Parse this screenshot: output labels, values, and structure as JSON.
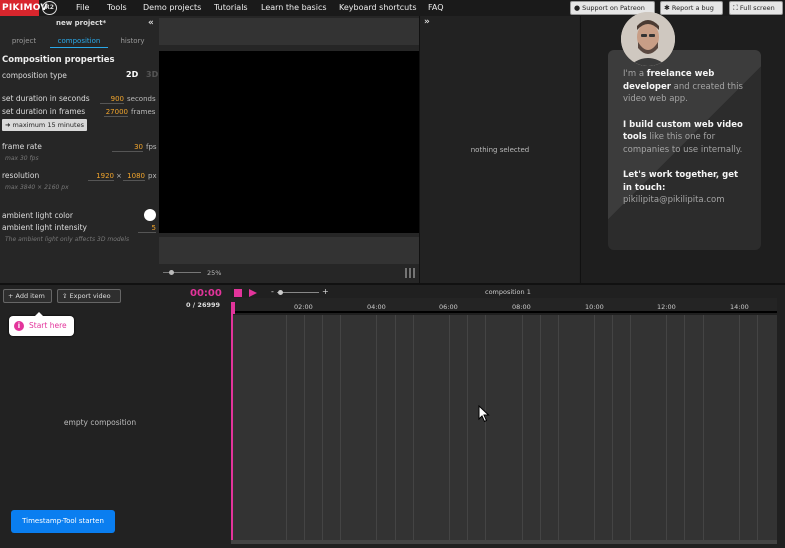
{
  "app": {
    "logo_text": "PIKIMOV",
    "badge": "R2"
  },
  "menu": [
    "File",
    "Tools",
    "Demo projects",
    "Tutorials",
    "Learn the basics",
    "Keyboard shortcuts",
    "FAQ"
  ],
  "top_buttons": {
    "patreon": "Support on Patreon",
    "bug": "Report a bug",
    "fullscreen": "Full screen"
  },
  "left_panel": {
    "project_title": "new project*",
    "collapse_glyph": "«",
    "tabs": [
      "project",
      "composition",
      "history"
    ],
    "active_tab": "composition",
    "heading": "Composition properties",
    "composition_type_label": "composition type",
    "type_2d": "2D",
    "type_3d": "3D",
    "duration_seconds_label": "set duration in seconds",
    "duration_seconds_value": "900",
    "duration_seconds_unit": "seconds",
    "duration_frames_label": "set duration in frames",
    "duration_frames_value": "27000",
    "duration_frames_unit": "frames",
    "max_button": "➜ maximum 15 minutes",
    "frame_rate_label": "frame rate",
    "frame_rate_value": "30",
    "frame_rate_unit": "fps",
    "frame_rate_hint": "max 30 fps",
    "resolution_label": "resolution",
    "res_w": "1920",
    "res_x": "×",
    "res_h": "1080",
    "res_unit": "px",
    "resolution_hint": "max 3840 × 2160 px",
    "ambient_color_label": "ambient light color",
    "ambient_intensity_label": "ambient light intensity",
    "ambient_intensity_value": "5",
    "ambient_hint": "The ambient light only affects 3D models",
    "ambient_color": "#ffffff"
  },
  "viewer": {
    "zoom": "25%"
  },
  "inspector": {
    "expand_glyph": "»",
    "nothing_selected": "nothing selected"
  },
  "promo": {
    "p1_pre": "I'm a ",
    "p1_bold": "freelance web developer",
    "p1_post": " and created this video web app.",
    "p2_bold": "I build custom web video tools",
    "p2_post": " like this one for companies to use internally.",
    "p3_bold": "Let's work together, get in touch:",
    "email": "pikilipita@pikilipita.com"
  },
  "timeline": {
    "add_item": "+ Add item",
    "export_video": "Export video",
    "start_here": "Start here",
    "start_icon": "i",
    "empty": "empty composition",
    "timestamp_button": "Timestamp-Tool starten",
    "time": "00:00",
    "frames": "0 / 26999",
    "zoom_minus": "-",
    "zoom_plus": "+",
    "composition_name": "composition 1",
    "ticks": [
      "02:00",
      "04:00",
      "06:00",
      "08:00",
      "10:00",
      "12:00",
      "14:00"
    ]
  },
  "colors": {
    "accent_pink": "#e3349b",
    "accent_blue": "#2aa8e8",
    "value_orange": "#f2a52c",
    "logo_red": "#d8262d",
    "button_blue": "#0a7ef0"
  }
}
